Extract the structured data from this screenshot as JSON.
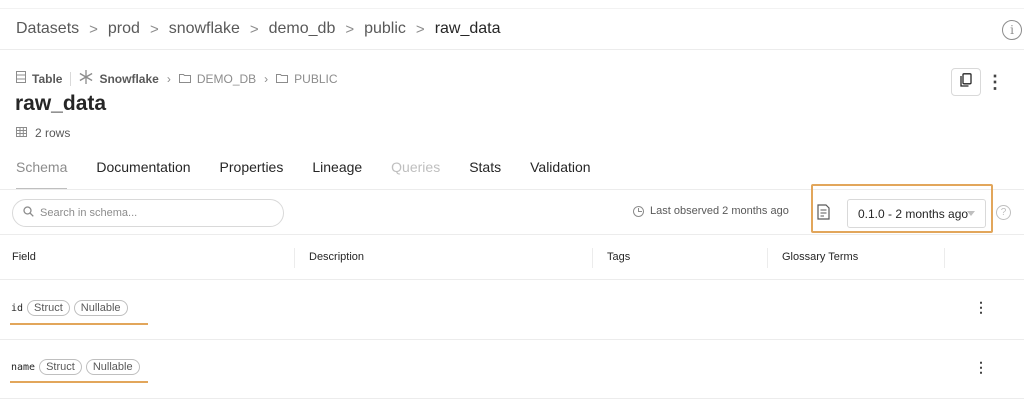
{
  "breadcrumb": {
    "items": [
      "Datasets",
      "prod",
      "snowflake",
      "demo_db",
      "public",
      "raw_data"
    ],
    "separator": ">"
  },
  "info_icon": {
    "icon": "info-icon",
    "glyph": "i"
  },
  "entity": {
    "type_label": "Table",
    "platform": "Snowflake",
    "path": [
      "DEMO_DB",
      "PUBLIC"
    ],
    "name": "raw_data",
    "row_count": "2 rows"
  },
  "tabs": [
    {
      "label": "Schema",
      "state": "active"
    },
    {
      "label": "Documentation",
      "state": "normal"
    },
    {
      "label": "Properties",
      "state": "normal"
    },
    {
      "label": "Lineage",
      "state": "normal"
    },
    {
      "label": "Queries",
      "state": "disabled"
    },
    {
      "label": "Stats",
      "state": "normal"
    },
    {
      "label": "Validation",
      "state": "normal"
    }
  ],
  "toolbar": {
    "search_placeholder": "Search in schema...",
    "last_observed": "Last observed 2 months ago",
    "version_selected": "0.1.0 - 2 months ago",
    "help_glyph": "?"
  },
  "table": {
    "columns": [
      "Field",
      "Description",
      "Tags",
      "Glossary Terms"
    ],
    "rows": [
      {
        "field": "id",
        "badges": [
          "Struct",
          "Nullable"
        ]
      },
      {
        "field": "name",
        "badges": [
          "Struct",
          "Nullable"
        ]
      }
    ]
  },
  "colors": {
    "highlight": "#e2a65b",
    "border": "#d9d9d9",
    "text": "#262626",
    "muted": "#8c8c8c"
  }
}
